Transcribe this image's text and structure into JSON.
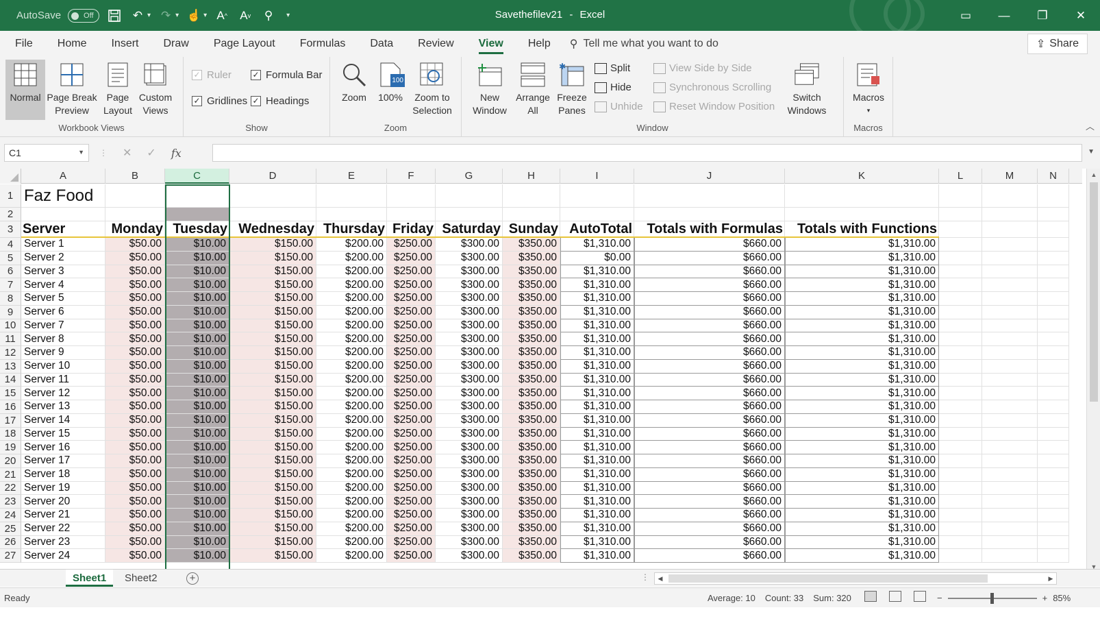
{
  "titlebar": {
    "autosave_label": "AutoSave",
    "autosave_state": "Off",
    "filename": "Savethefilev21",
    "separator": "-",
    "app": "Excel",
    "accent_color": "#217346"
  },
  "tabs": [
    "File",
    "Home",
    "Insert",
    "Draw",
    "Page Layout",
    "Formulas",
    "Data",
    "Review",
    "View",
    "Help"
  ],
  "active_tab": "View",
  "tellme": "Tell me what you want to do",
  "share": "Share",
  "ribbon": {
    "workbook_views": {
      "label": "Workbook Views",
      "normal": "Normal",
      "page_break_1": "Page Break",
      "page_break_2": "Preview",
      "page_layout_1": "Page",
      "page_layout_2": "Layout",
      "custom_1": "Custom",
      "custom_2": "Views"
    },
    "show": {
      "label": "Show",
      "ruler": "Ruler",
      "formula_bar": "Formula Bar",
      "gridlines": "Gridlines",
      "headings": "Headings"
    },
    "zoom": {
      "label": "Zoom",
      "zoom": "Zoom",
      "hundred": "100%",
      "hundred_icon": "100",
      "sel_1": "Zoom to",
      "sel_2": "Selection"
    },
    "window": {
      "label": "Window",
      "new_1": "New",
      "new_2": "Window",
      "arrange_1": "Arrange",
      "arrange_2": "All",
      "freeze_1": "Freeze",
      "freeze_2": "Panes",
      "split": "Split",
      "hide": "Hide",
      "unhide": "Unhide",
      "side_by_side": "View Side by Side",
      "sync_scroll": "Synchronous Scrolling",
      "reset_pos": "Reset Window Position",
      "switch_1": "Switch",
      "switch_2": "Windows"
    },
    "macros": {
      "label": "Macros",
      "macros": "Macros"
    }
  },
  "formula_bar": {
    "name_box": "C1",
    "fx": "fx",
    "value": ""
  },
  "columns": [
    "A",
    "B",
    "C",
    "D",
    "E",
    "F",
    "G",
    "H",
    "I",
    "J",
    "K",
    "L",
    "M",
    "N"
  ],
  "sheet": {
    "title": "Faz Food",
    "headers": [
      "Server",
      "Monday",
      "Tuesday",
      "Wednesday",
      "Thursday",
      "Friday",
      "Saturday",
      "Sunday",
      "AutoTotal",
      "Totals with Formulas",
      "Totals with Functions"
    ],
    "rows": [
      [
        "Server 1",
        "$50.00",
        "$10.00",
        "$150.00",
        "$200.00",
        "$250.00",
        "$300.00",
        "$350.00",
        "$1,310.00",
        "$660.00",
        "$1,310.00"
      ],
      [
        "Server 2",
        "$50.00",
        "$10.00",
        "$150.00",
        "$200.00",
        "$250.00",
        "$300.00",
        "$350.00",
        "$0.00",
        "$660.00",
        "$1,310.00"
      ],
      [
        "Server 3",
        "$50.00",
        "$10.00",
        "$150.00",
        "$200.00",
        "$250.00",
        "$300.00",
        "$350.00",
        "$1,310.00",
        "$660.00",
        "$1,310.00"
      ],
      [
        "Server 4",
        "$50.00",
        "$10.00",
        "$150.00",
        "$200.00",
        "$250.00",
        "$300.00",
        "$350.00",
        "$1,310.00",
        "$660.00",
        "$1,310.00"
      ],
      [
        "Server 5",
        "$50.00",
        "$10.00",
        "$150.00",
        "$200.00",
        "$250.00",
        "$300.00",
        "$350.00",
        "$1,310.00",
        "$660.00",
        "$1,310.00"
      ],
      [
        "Server 6",
        "$50.00",
        "$10.00",
        "$150.00",
        "$200.00",
        "$250.00",
        "$300.00",
        "$350.00",
        "$1,310.00",
        "$660.00",
        "$1,310.00"
      ],
      [
        "Server 7",
        "$50.00",
        "$10.00",
        "$150.00",
        "$200.00",
        "$250.00",
        "$300.00",
        "$350.00",
        "$1,310.00",
        "$660.00",
        "$1,310.00"
      ],
      [
        "Server 8",
        "$50.00",
        "$10.00",
        "$150.00",
        "$200.00",
        "$250.00",
        "$300.00",
        "$350.00",
        "$1,310.00",
        "$660.00",
        "$1,310.00"
      ],
      [
        "Server 9",
        "$50.00",
        "$10.00",
        "$150.00",
        "$200.00",
        "$250.00",
        "$300.00",
        "$350.00",
        "$1,310.00",
        "$660.00",
        "$1,310.00"
      ],
      [
        "Server 10",
        "$50.00",
        "$10.00",
        "$150.00",
        "$200.00",
        "$250.00",
        "$300.00",
        "$350.00",
        "$1,310.00",
        "$660.00",
        "$1,310.00"
      ],
      [
        "Server 11",
        "$50.00",
        "$10.00",
        "$150.00",
        "$200.00",
        "$250.00",
        "$300.00",
        "$350.00",
        "$1,310.00",
        "$660.00",
        "$1,310.00"
      ],
      [
        "Server 12",
        "$50.00",
        "$10.00",
        "$150.00",
        "$200.00",
        "$250.00",
        "$300.00",
        "$350.00",
        "$1,310.00",
        "$660.00",
        "$1,310.00"
      ],
      [
        "Server 13",
        "$50.00",
        "$10.00",
        "$150.00",
        "$200.00",
        "$250.00",
        "$300.00",
        "$350.00",
        "$1,310.00",
        "$660.00",
        "$1,310.00"
      ],
      [
        "Server 14",
        "$50.00",
        "$10.00",
        "$150.00",
        "$200.00",
        "$250.00",
        "$300.00",
        "$350.00",
        "$1,310.00",
        "$660.00",
        "$1,310.00"
      ],
      [
        "Server 15",
        "$50.00",
        "$10.00",
        "$150.00",
        "$200.00",
        "$250.00",
        "$300.00",
        "$350.00",
        "$1,310.00",
        "$660.00",
        "$1,310.00"
      ],
      [
        "Server 16",
        "$50.00",
        "$10.00",
        "$150.00",
        "$200.00",
        "$250.00",
        "$300.00",
        "$350.00",
        "$1,310.00",
        "$660.00",
        "$1,310.00"
      ],
      [
        "Server 17",
        "$50.00",
        "$10.00",
        "$150.00",
        "$200.00",
        "$250.00",
        "$300.00",
        "$350.00",
        "$1,310.00",
        "$660.00",
        "$1,310.00"
      ],
      [
        "Server 18",
        "$50.00",
        "$10.00",
        "$150.00",
        "$200.00",
        "$250.00",
        "$300.00",
        "$350.00",
        "$1,310.00",
        "$660.00",
        "$1,310.00"
      ],
      [
        "Server 19",
        "$50.00",
        "$10.00",
        "$150.00",
        "$200.00",
        "$250.00",
        "$300.00",
        "$350.00",
        "$1,310.00",
        "$660.00",
        "$1,310.00"
      ],
      [
        "Server 20",
        "$50.00",
        "$10.00",
        "$150.00",
        "$200.00",
        "$250.00",
        "$300.00",
        "$350.00",
        "$1,310.00",
        "$660.00",
        "$1,310.00"
      ],
      [
        "Server 21",
        "$50.00",
        "$10.00",
        "$150.00",
        "$200.00",
        "$250.00",
        "$300.00",
        "$350.00",
        "$1,310.00",
        "$660.00",
        "$1,310.00"
      ],
      [
        "Server 22",
        "$50.00",
        "$10.00",
        "$150.00",
        "$200.00",
        "$250.00",
        "$300.00",
        "$350.00",
        "$1,310.00",
        "$660.00",
        "$1,310.00"
      ],
      [
        "Server 23",
        "$50.00",
        "$10.00",
        "$150.00",
        "$200.00",
        "$250.00",
        "$300.00",
        "$350.00",
        "$1,310.00",
        "$660.00",
        "$1,310.00"
      ],
      [
        "Server 24",
        "$50.00",
        "$10.00",
        "$150.00",
        "$200.00",
        "$250.00",
        "$300.00",
        "$350.00",
        "$1,310.00",
        "$660.00",
        "$1,310.00"
      ]
    ]
  },
  "sheet_tabs": [
    "Sheet1",
    "Sheet2"
  ],
  "active_sheet": "Sheet1",
  "status": {
    "ready": "Ready",
    "average": "Average: 10",
    "count": "Count: 33",
    "sum": "Sum: 320",
    "zoom": "85%"
  }
}
